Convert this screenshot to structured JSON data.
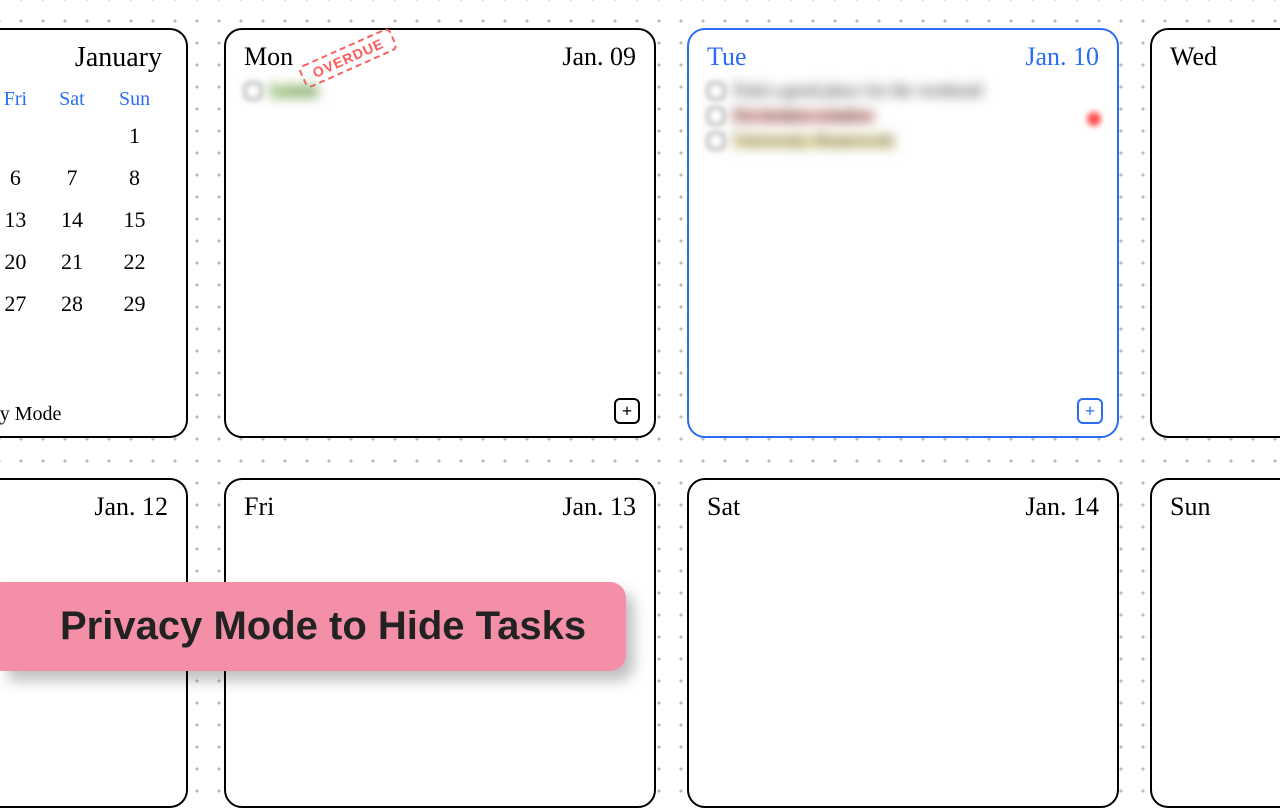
{
  "miniCalendar": {
    "month": "January",
    "headers": [
      "Fri",
      "Sat",
      "Sun"
    ],
    "rows": [
      [
        "",
        "",
        "1"
      ],
      [
        "6",
        "7",
        "8"
      ],
      [
        "13",
        "14",
        "15"
      ],
      [
        "20",
        "21",
        "22"
      ],
      [
        "27",
        "28",
        "29"
      ]
    ],
    "privacyLabel": "acy Mode"
  },
  "days": {
    "mon": {
      "dow": "Mon",
      "date": "Jan. 09",
      "overdue": "OVERDUE"
    },
    "tue": {
      "dow": "Tue",
      "date": "Jan. 10"
    },
    "wed": {
      "dow": "Wed",
      "date": ""
    },
    "thu12": {
      "dow": "",
      "date": "Jan. 12"
    },
    "fri": {
      "dow": "Fri",
      "date": "Jan. 13"
    },
    "sat": {
      "dow": "Sat",
      "date": "Jan. 14"
    },
    "sun": {
      "dow": "Sun",
      "date": ""
    }
  },
  "tasks": {
    "mon": [
      {
        "text": "Lorem",
        "highlight": "green"
      }
    ],
    "tue": [
      {
        "text": "Find a good place for the weekend",
        "highlight": ""
      },
      {
        "text": "Fix broken window",
        "highlight": "red"
      },
      {
        "text": "University Homework",
        "highlight": "yellow"
      }
    ]
  },
  "banner": "Privacy Mode to Hide Tasks",
  "addLabel": "+"
}
